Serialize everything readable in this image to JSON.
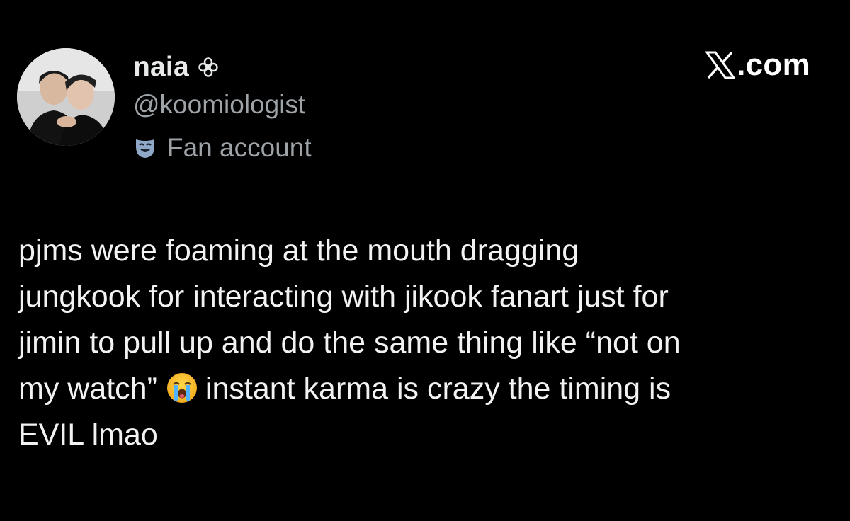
{
  "author": {
    "display_name": "naia",
    "name_suffix_icon": "flower-icon",
    "handle": "@koomiologist",
    "account_label": "Fan account",
    "account_label_icon": "theater-mask-icon",
    "avatar_icon": "profile-photo"
  },
  "brand": {
    "logo_icon": "x-logo-icon",
    "suffix": ".com"
  },
  "tweet": {
    "line_1": "pjms were foaming at the mouth dragging",
    "line_2": "jungkook for interacting with jikook fanart just for",
    "line_3": "jimin to pull up and do the same thing like “not on",
    "line_4_before_emoji": "my watch”",
    "emoji": "loudly-crying-face-emoji",
    "line_4_after_emoji": "instant karma is crazy the timing is",
    "line_5": "EVIL lmao"
  },
  "colors": {
    "background": "#000000",
    "primary_text": "#e7e9ea",
    "secondary_text": "#9ea3a8",
    "mask_badge": "#8fa8c8"
  }
}
